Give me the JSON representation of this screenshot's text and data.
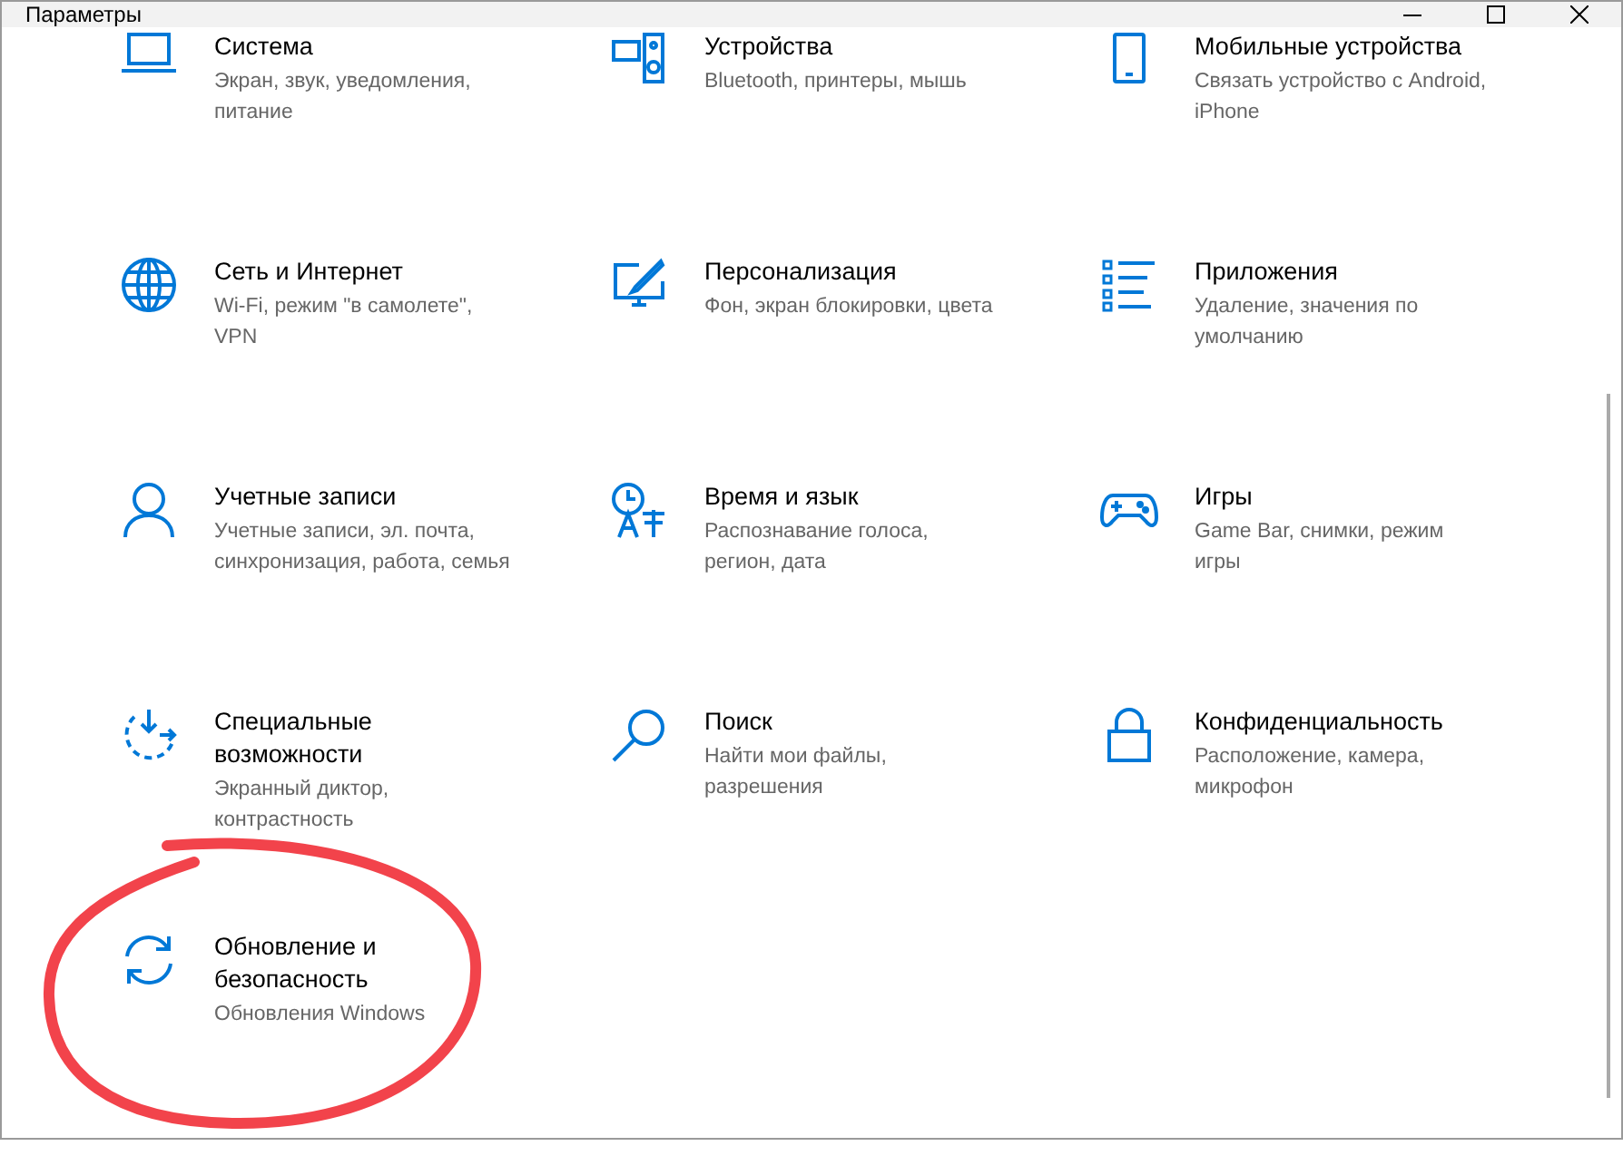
{
  "window": {
    "title": "Параметры"
  },
  "tiles": [
    {
      "title": "Система",
      "description": "Экран, звук, уведомления, питание"
    },
    {
      "title": "Устройства",
      "description": "Bluetooth, принтеры, мышь"
    },
    {
      "title": "Мобильные устройства",
      "description": "Связать устройство с Android, iPhone"
    },
    {
      "title": "Сеть и Интернет",
      "description": "Wi-Fi, режим \"в самолете\", VPN"
    },
    {
      "title": "Персонализация",
      "description": "Фон, экран блокировки, цвета"
    },
    {
      "title": "Приложения",
      "description": "Удаление, значения по умолчанию"
    },
    {
      "title": "Учетные записи",
      "description": "Учетные записи, эл. почта, синхронизация, работа, семья"
    },
    {
      "title": "Время и язык",
      "description": "Распознавание голоса, регион, дата"
    },
    {
      "title": "Игры",
      "description": "Game Bar, снимки, режим игры"
    },
    {
      "title": "Специальные возможности",
      "description": "Экранный диктор, контрастность"
    },
    {
      "title": "Поиск",
      "description": "Найти мои файлы, разрешения"
    },
    {
      "title": "Конфиденциальность",
      "description": "Расположение, камера, микрофон"
    },
    {
      "title": "Обновление и безопасность",
      "description": "Обновления Windows"
    }
  ]
}
